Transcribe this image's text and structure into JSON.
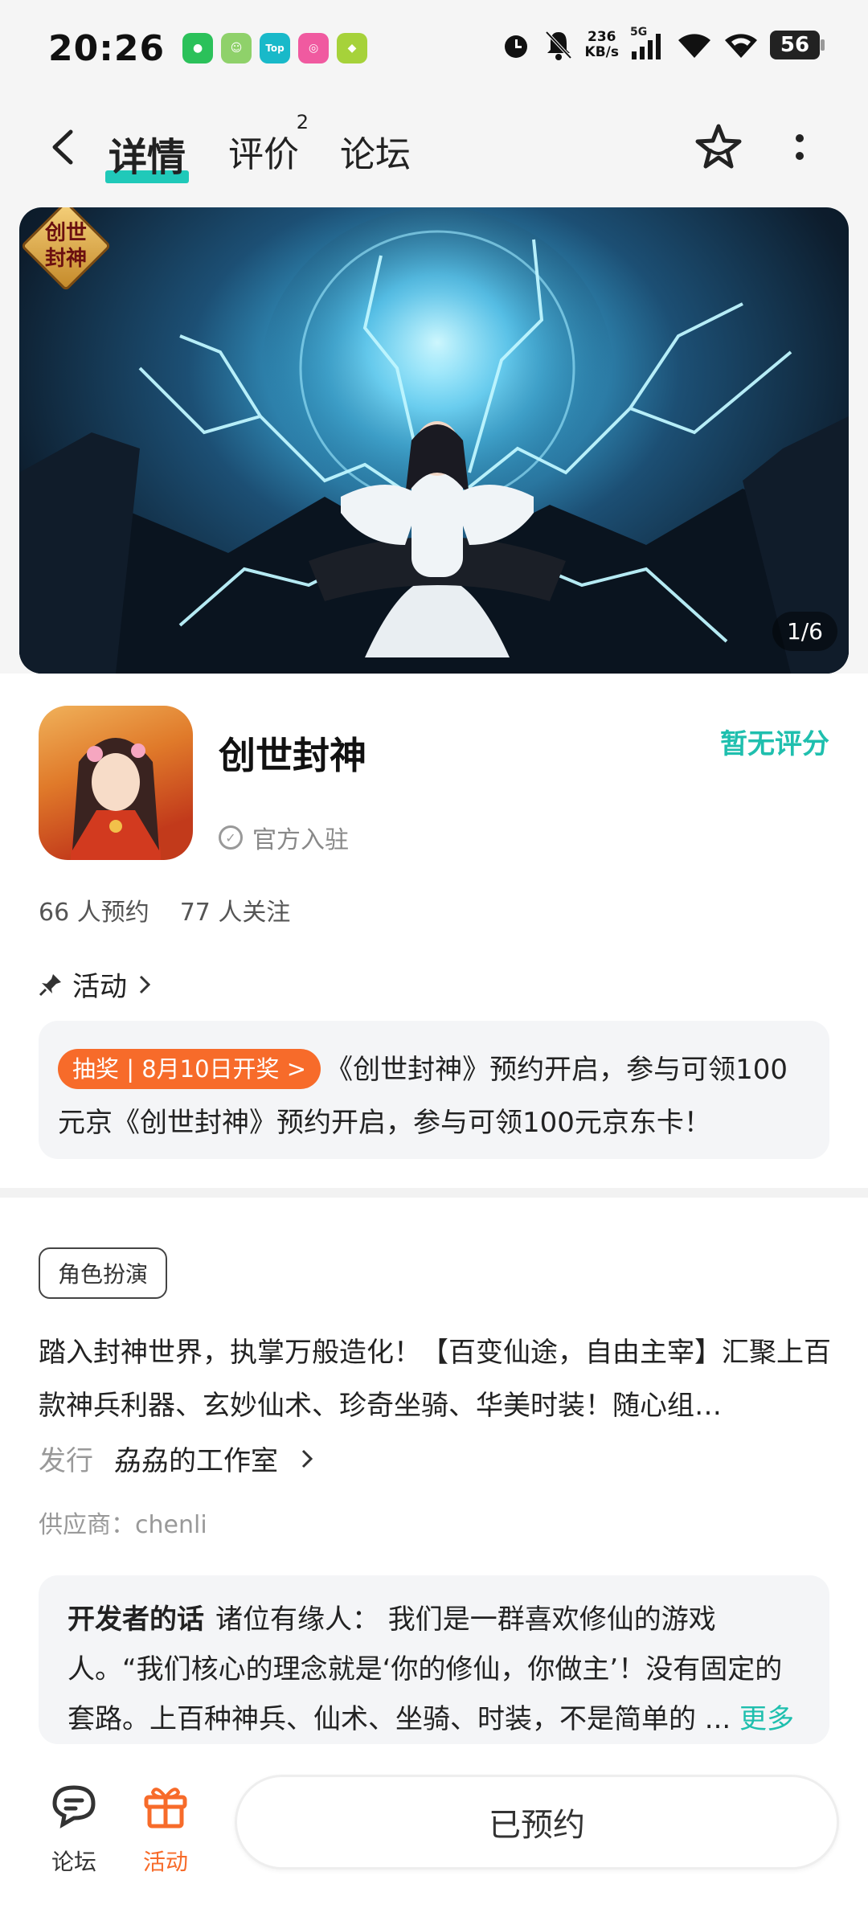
{
  "status_bar": {
    "time": "20:26",
    "net_speed_value": "236",
    "net_speed_unit": "KB/s",
    "network": "5G",
    "battery": "56",
    "notification_apps": [
      "wechat-icon",
      "app-icon",
      "topbuzz-icon",
      "camera-app-icon",
      "game-app-icon"
    ]
  },
  "nav": {
    "tabs": [
      {
        "label": "详情"
      },
      {
        "label": "评价",
        "badge": "2"
      },
      {
        "label": "论坛"
      }
    ]
  },
  "banner": {
    "logo_text": "创世封神",
    "page_indicator": "1/6"
  },
  "app": {
    "name": "创世封神",
    "official_label": "官方入驻",
    "rating": "暂无评分",
    "reservations": "66 人预约",
    "followers": "77 人关注"
  },
  "activity": {
    "heading": "活动",
    "tag": "抽奖 | 8月10日开奖 >",
    "text": "《创世封神》预约开启，参与可领100元京《创世封神》预约开启，参与可领100元京东卡！"
  },
  "description": {
    "genre": "角色扮演",
    "text": "踏入封神世界，执掌万般造化！【百变仙途，自由主宰】汇聚上百款神兵利器、玄妙仙术、珍奇坐骑、华美时装！随心组…",
    "publisher_label": "发行",
    "publisher": "劦劦的工作室",
    "supplier": "供应商：chenli"
  },
  "developer_note": {
    "title": "开发者的话",
    "text": "诸位有缘人： 我们是一群喜欢修仙的游戏人。“我们核心的理念就是‘你的修仙，你做主’！没有固定的套路。上百种神兵、仙术、坐骑、时装，不是简单的 ...",
    "more": "更多"
  },
  "bottom_bar": {
    "forum_label": "论坛",
    "activity_label": "活动",
    "reserve_button": "已预约"
  },
  "colors": {
    "accent": "#20c9b9",
    "orange": "#f76b2a"
  }
}
